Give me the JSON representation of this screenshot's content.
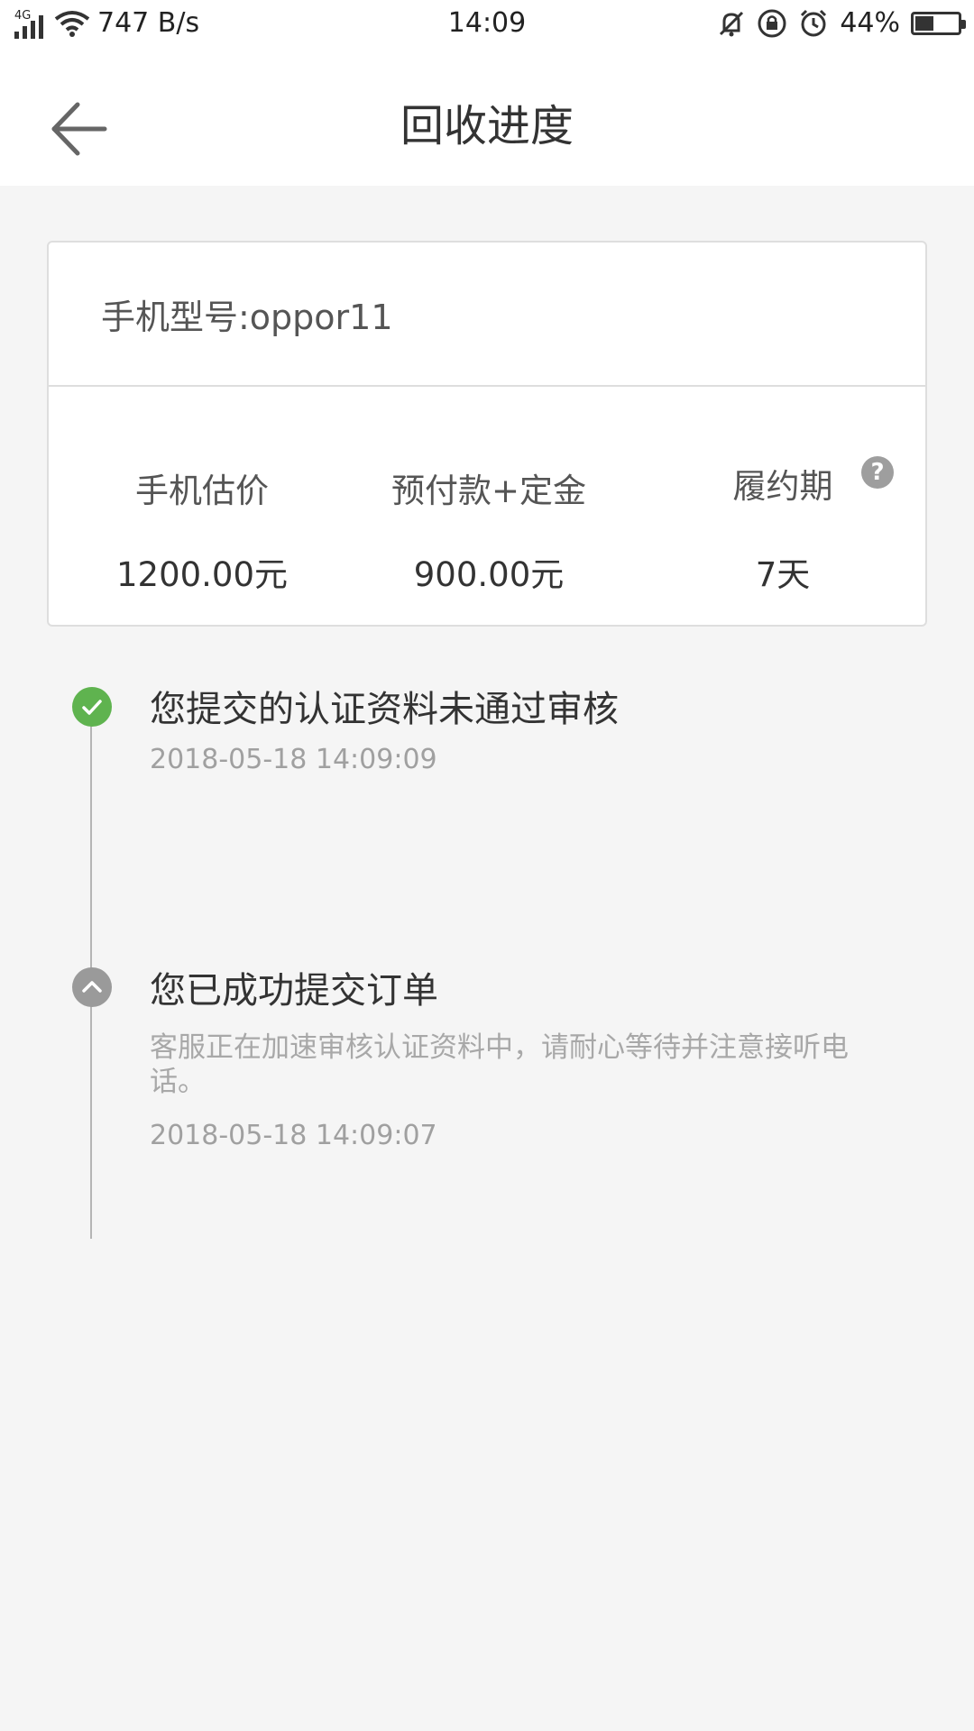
{
  "status_bar": {
    "network": "4G",
    "speed": "747 B/s",
    "time": "14:09",
    "battery": "44%",
    "battery_level": 0.44
  },
  "header": {
    "title": "回收进度"
  },
  "card": {
    "model": "手机型号:oppor11",
    "stats": [
      {
        "label": "手机估价",
        "value": "1200.00元"
      },
      {
        "label": "预付款+定金",
        "value": "900.00元"
      },
      {
        "label": "履约期",
        "value": "7天"
      }
    ],
    "help_symbol": "?"
  },
  "timeline": [
    {
      "title": "您提交的认证资料未通过审核",
      "time": "2018-05-18 14:09:09",
      "status_color": "#5fb34f",
      "icon": "check-icon"
    },
    {
      "title": "您已成功提交订单",
      "description": "客服正在加速审核认证资料中，请耐心等待并注意接听电话。",
      "time": "2018-05-18 14:09:07",
      "status_color": "#9a9a9a",
      "icon": "chevron-up-icon"
    }
  ]
}
